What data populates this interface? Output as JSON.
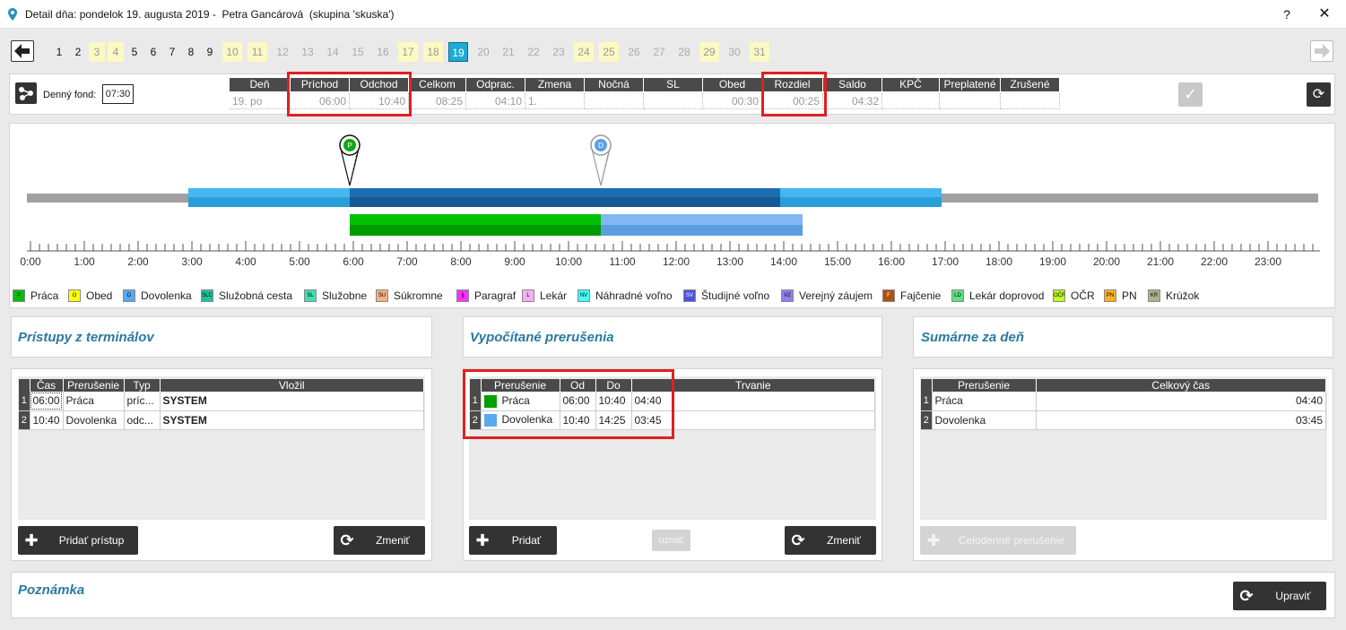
{
  "window": {
    "title": "Detail dňa: pondelok 19. augusta 2019 -  Petra Gancárová  (skupina 'skuska')",
    "help": "?",
    "close": "✕"
  },
  "days": [
    {
      "n": "1",
      "kind": "n"
    },
    {
      "n": "2",
      "kind": "n"
    },
    {
      "n": "3",
      "kind": "we"
    },
    {
      "n": "4",
      "kind": "we"
    },
    {
      "n": "5",
      "kind": "n"
    },
    {
      "n": "6",
      "kind": "n"
    },
    {
      "n": "7",
      "kind": "n"
    },
    {
      "n": "8",
      "kind": "n"
    },
    {
      "n": "9",
      "kind": "n"
    },
    {
      "n": "10",
      "kind": "we"
    },
    {
      "n": "11",
      "kind": "we"
    },
    {
      "n": "12",
      "kind": "fut"
    },
    {
      "n": "13",
      "kind": "fut"
    },
    {
      "n": "14",
      "kind": "fut"
    },
    {
      "n": "15",
      "kind": "fut"
    },
    {
      "n": "16",
      "kind": "fut"
    },
    {
      "n": "17",
      "kind": "we"
    },
    {
      "n": "18",
      "kind": "we"
    },
    {
      "n": "19",
      "kind": "sel"
    },
    {
      "n": "20",
      "kind": "fut"
    },
    {
      "n": "21",
      "kind": "fut"
    },
    {
      "n": "22",
      "kind": "fut"
    },
    {
      "n": "23",
      "kind": "fut"
    },
    {
      "n": "24",
      "kind": "we"
    },
    {
      "n": "25",
      "kind": "we"
    },
    {
      "n": "26",
      "kind": "fut"
    },
    {
      "n": "27",
      "kind": "fut"
    },
    {
      "n": "28",
      "kind": "fut"
    },
    {
      "n": "29",
      "kind": "we"
    },
    {
      "n": "30",
      "kind": "fut"
    },
    {
      "n": "31",
      "kind": "we"
    }
  ],
  "fund": {
    "label": "Denný fond:",
    "value": "07:30"
  },
  "summary": {
    "headers": [
      "Deň",
      "Príchod",
      "Odchod",
      "Celkom",
      "Odprac.",
      "Zmena",
      "Nočná",
      "SL",
      "Obed",
      "Rozdiel",
      "Saldo",
      "KPČ",
      "Preplatené",
      "Zrušené"
    ],
    "values": [
      "19. po",
      "06:00",
      "10:40",
      "08:25",
      "04:10",
      "1.",
      "",
      "",
      "00:30",
      "00:25",
      "04:32",
      "",
      "",
      ""
    ]
  },
  "timeline": {
    "hours": [
      "0:00",
      "1:00",
      "2:00",
      "3:00",
      "4:00",
      "5:00",
      "6:00",
      "7:00",
      "8:00",
      "9:00",
      "10:00",
      "11:00",
      "12:00",
      "13:00",
      "14:00",
      "15:00",
      "16:00",
      "17:00",
      "18:00",
      "19:00",
      "20:00",
      "21:00",
      "22:00",
      "23:00"
    ],
    "shift_outer": [
      3.0,
      17.0
    ],
    "shift_core": [
      6.0,
      14.0
    ],
    "bars": [
      {
        "from": 6.0,
        "to": 10.6667,
        "color": "#00c000"
      },
      {
        "from": 10.6667,
        "to": 14.4167,
        "color": "#7fb8f2"
      }
    ],
    "markers": [
      {
        "at": 6.0,
        "letter": "P",
        "color": "#0faa0f"
      },
      {
        "at": 10.6667,
        "letter": "D",
        "color": "#5aa0e8"
      }
    ]
  },
  "legend": [
    {
      "code": "P",
      "label": "Práca",
      "color": "#00c000"
    },
    {
      "code": "O",
      "label": "Obed",
      "color": "#ffff00"
    },
    {
      "code": "D",
      "label": "Dovolenka",
      "color": "#5aa8f0"
    },
    {
      "code": "SLC",
      "label": "Služobná cesta",
      "color": "#20c0a0"
    },
    {
      "code": "SL",
      "label": "Služobne",
      "color": "#40e0b0"
    },
    {
      "code": "SU",
      "label": "Súkromne",
      "color": "#f4b080"
    },
    {
      "code": "§",
      "label": "Paragraf",
      "color": "#ff30ff"
    },
    {
      "code": "L",
      "label": "Lekár",
      "color": "#f4b0f4"
    },
    {
      "code": "NV",
      "label": "Náhradné voľno",
      "color": "#40ffff"
    },
    {
      "code": "SV",
      "label": "Študijné voľno",
      "color": "#5050e0"
    },
    {
      "code": "VZ",
      "label": "Verejný záujem",
      "color": "#9080f0"
    },
    {
      "code": "F",
      "label": "Fajčenie",
      "color": "#b05010"
    },
    {
      "code": "LD",
      "label": "Lekár doprovod",
      "color": "#60e080"
    },
    {
      "code": "OČR",
      "label": "OČR",
      "color": "#c0ff20"
    },
    {
      "code": "PN",
      "label": "PN",
      "color": "#ffb020"
    },
    {
      "code": "KR",
      "label": "Krúžok",
      "color": "#b0b090"
    }
  ],
  "access": {
    "title": "Prístupy z terminálov",
    "headers": [
      "Čas",
      "Prerušenie",
      "Typ",
      "Vložil"
    ],
    "rows": [
      {
        "n": "1",
        "time": "06:00",
        "interrupt": "Práca",
        "type": "príc...",
        "by": "SYSTEM"
      },
      {
        "n": "2",
        "time": "10:40",
        "interrupt": "Dovolenka",
        "type": "odc...",
        "by": "SYSTEM"
      }
    ],
    "add_label": "Pridať prístup",
    "change_label": "Zmeniť"
  },
  "computed": {
    "title": "Vypočítané prerušenia",
    "headers": [
      "Prerušenie",
      "Od",
      "Do",
      "Trvanie"
    ],
    "rows": [
      {
        "n": "1",
        "color": "#00a000",
        "name": "Práca",
        "from": "06:00",
        "to": "10:40",
        "dur": "04:40"
      },
      {
        "n": "2",
        "color": "#5aa8f0",
        "name": "Dovolenka",
        "from": "10:40",
        "to": "14:25",
        "dur": "03:45"
      }
    ],
    "add_label": "Pridať",
    "accept_label": "uznať",
    "change_label": "Zmeniť"
  },
  "daily": {
    "title": "Sumárne za deň",
    "headers": [
      "Prerušenie",
      "Celkový čas"
    ],
    "rows": [
      {
        "n": "1",
        "name": "Práca",
        "total": "04:40"
      },
      {
        "n": "2",
        "name": "Dovolenka",
        "total": "03:45"
      }
    ],
    "fullday_label": "Celodenné prerušenie"
  },
  "note": {
    "title": "Poznámka",
    "edit_label": "Upraviť"
  }
}
